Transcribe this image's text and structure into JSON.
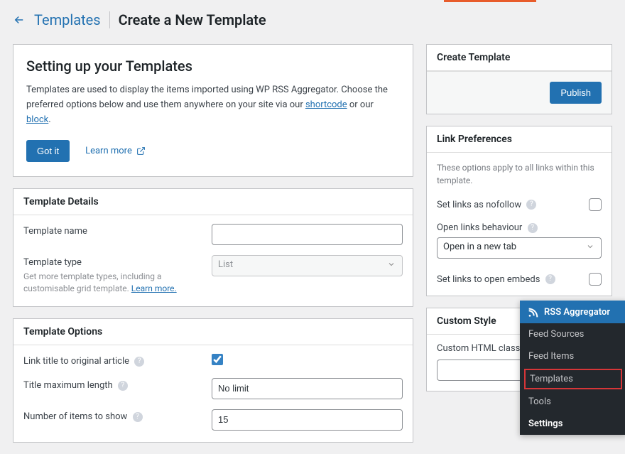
{
  "breadcrumb": {
    "back_label": "Templates"
  },
  "page_title": "Create a New Template",
  "intro": {
    "title": "Setting up your Templates",
    "text_before": "Templates are used to display the items imported using WP RSS Aggregator. Choose the preferred options below and use them anywhere on your site via our ",
    "link_shortcode": "shortcode",
    "text_mid": " or our ",
    "link_block": "block",
    "text_end": ".",
    "got_it": "Got it",
    "learn_more": "Learn more"
  },
  "template_details": {
    "header": "Template Details",
    "name_label": "Template name",
    "name_value": "",
    "type_label": "Template type",
    "type_value": "List",
    "type_sub_before": "Get more template types, including a customisable grid template. ",
    "type_sub_link": "Learn more."
  },
  "template_options": {
    "header": "Template Options",
    "link_title_label": "Link title to original article",
    "link_title_checked": true,
    "title_max_label": "Title maximum length",
    "title_max_value": "No limit",
    "num_items_label": "Number of items to show",
    "num_items_value": "15"
  },
  "create_box": {
    "header": "Create Template",
    "publish": "Publish"
  },
  "link_prefs": {
    "header": "Link Preferences",
    "subtle": "These options apply to all links within this template.",
    "nofollow_label": "Set links as nofollow",
    "behaviour_label": "Open links behaviour",
    "behaviour_value": "Open in a new tab",
    "embeds_label": "Set links to open embeds"
  },
  "custom_style": {
    "header": "Custom Style",
    "class_label": "Custom HTML class",
    "class_value": ""
  },
  "admin_menu": {
    "title": "RSS Aggregator",
    "items": [
      "Feed Sources",
      "Feed Items",
      "Templates",
      "Tools",
      "Settings"
    ]
  }
}
